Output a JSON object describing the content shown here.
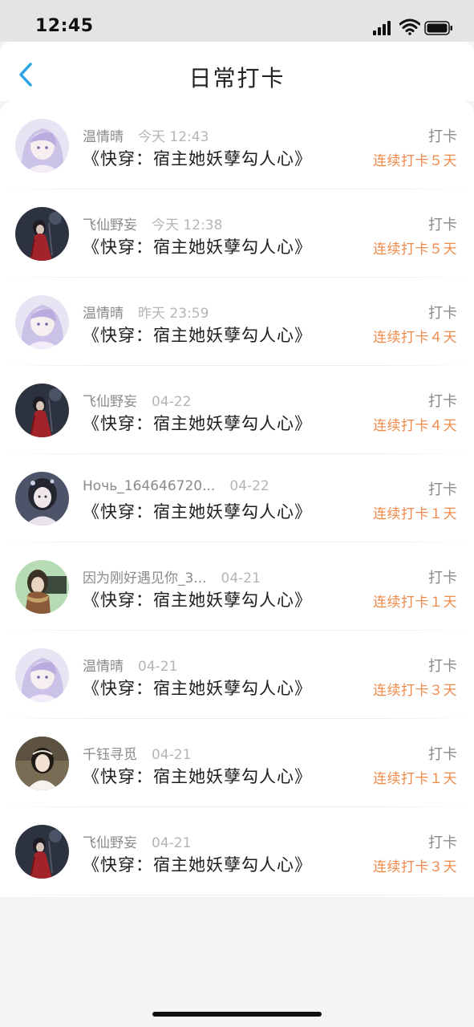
{
  "status": {
    "time": "12:45"
  },
  "header": {
    "title": "日常打卡"
  },
  "icons": {
    "back": "chevron-left-icon",
    "signal": "signal-icon",
    "wifi": "wifi-icon",
    "battery": "battery-icon"
  },
  "colors": {
    "accent": "#2aa3e5",
    "streak": "#f08a4b"
  },
  "records": [
    {
      "user": "温情晴",
      "time": "今天 12:43",
      "book": "《快穿：宿主她妖孽勾人心》",
      "action": "打卡",
      "streak": "连续打卡５天",
      "avatar": "anime-girl-lavender"
    },
    {
      "user": "飞仙野妄",
      "time": "今天 12:38",
      "book": "《快穿：宿主她妖孽勾人心》",
      "action": "打卡",
      "streak": "连续打卡５天",
      "avatar": "dark-red-robe"
    },
    {
      "user": "温情晴",
      "time": "昨天 23:59",
      "book": "《快穿：宿主她妖孽勾人心》",
      "action": "打卡",
      "streak": "连续打卡４天",
      "avatar": "anime-girl-lavender"
    },
    {
      "user": "飞仙野妄",
      "time": "04-22",
      "book": "《快穿：宿主她妖孽勾人心》",
      "action": "打卡",
      "streak": "连续打卡４天",
      "avatar": "dark-red-robe"
    },
    {
      "user": "Ночь_164646720...",
      "time": "04-22",
      "book": "《快穿：宿主她妖孽勾人心》",
      "action": "打卡",
      "streak": "连续打卡１天",
      "avatar": "dark-haired-girl"
    },
    {
      "user": "因为刚好遇见你_3...",
      "time": "04-21",
      "book": "《快穿：宿主她妖孽勾人心》",
      "action": "打卡",
      "streak": "连续打卡１天",
      "avatar": "green-scarf"
    },
    {
      "user": "温情晴",
      "time": "04-21",
      "book": "《快穿：宿主她妖孽勾人心》",
      "action": "打卡",
      "streak": "连续打卡３天",
      "avatar": "anime-girl-lavender"
    },
    {
      "user": "千钰寻觅",
      "time": "04-21",
      "book": "《快穿：宿主她妖孽勾人心》",
      "action": "打卡",
      "streak": "连续打卡１天",
      "avatar": "photo-girl"
    },
    {
      "user": "飞仙野妄",
      "time": "04-21",
      "book": "《快穿：宿主她妖孽勾人心》",
      "action": "打卡",
      "streak": "连续打卡３天",
      "avatar": "dark-red-robe"
    }
  ]
}
